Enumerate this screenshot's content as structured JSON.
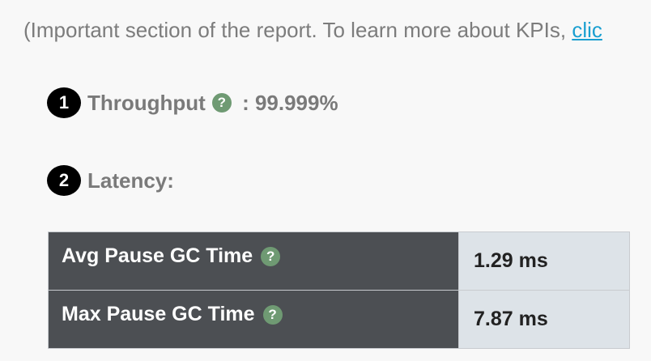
{
  "intro": {
    "text": "(Important section of the report. To learn more about KPIs, ",
    "link": "clic"
  },
  "kpis": [
    {
      "number": "1",
      "label": "Throughput",
      "help_icon": "question-circle-icon",
      "separator": " : ",
      "value": "99.999%"
    },
    {
      "number": "2",
      "label": "Latency:"
    }
  ],
  "latency_table": {
    "rows": [
      {
        "metric": "Avg Pause GC Time",
        "value": "1.29 ms"
      },
      {
        "metric": "Max Pause GC Time",
        "value": "7.87 ms"
      }
    ]
  },
  "colors": {
    "help_icon": "#6f9a73",
    "link": "#1a9fd0",
    "table_header_bg": "#4c4f53",
    "table_value_bg": "#dde3e8"
  }
}
